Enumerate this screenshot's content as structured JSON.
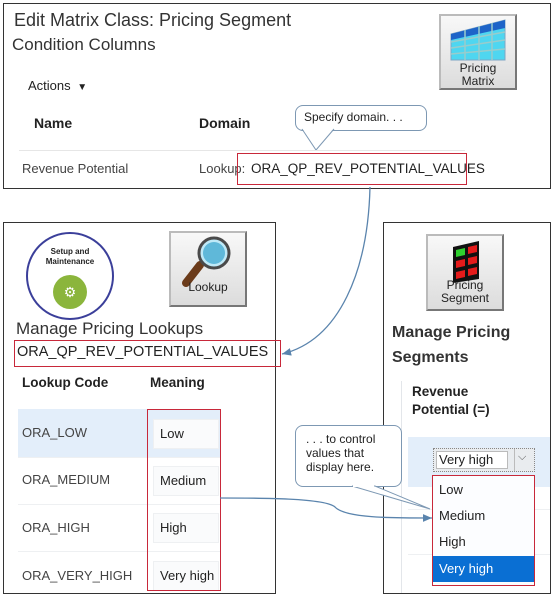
{
  "top_panel": {
    "title": "Edit Matrix Class: Pricing Segment",
    "subtitle": "Condition Columns",
    "actions_label": "Actions",
    "icon_tile": {
      "icon": "pricing-matrix-icon",
      "label_line1": "Pricing",
      "label_line2": "Matrix"
    },
    "table": {
      "headers": [
        "Name",
        "Domain"
      ],
      "rows": [
        {
          "name": "Revenue Potential",
          "domain_prefix": "Lookup:",
          "domain_value": "ORA_QP_REV_POTENTIAL_VALUES"
        }
      ]
    },
    "callout": "Specify domain. . ."
  },
  "left_panel": {
    "setup_badge": {
      "line1": "Setup and",
      "line2": "Maintenance",
      "icon": "gears-icon"
    },
    "lookup_tile": {
      "icon": "magnifier-icon",
      "label": "Lookup"
    },
    "title": "Manage Pricing Lookups",
    "lookup_type": "ORA_QP_REV_POTENTIAL_VALUES",
    "table": {
      "headers": [
        "Lookup Code",
        "Meaning"
      ],
      "rows": [
        {
          "code": "ORA_LOW",
          "meaning": "Low"
        },
        {
          "code": "ORA_MEDIUM",
          "meaning": "Medium"
        },
        {
          "code": "ORA_HIGH",
          "meaning": "High"
        },
        {
          "code": "ORA_VERY_HIGH",
          "meaning": "Very high"
        }
      ]
    }
  },
  "right_panel": {
    "segment_tile": {
      "icon": "pricing-segment-icon",
      "label_line1": "Pricing",
      "label_line2": "Segment"
    },
    "title_line1": "Manage Pricing",
    "title_line2": "Segments",
    "column_header_line1": "Revenue",
    "column_header_line2": "Potential (=)",
    "select": {
      "value": "Very high",
      "options": [
        "Low",
        "Medium",
        "High",
        "Very high"
      ],
      "highlighted": "Very high"
    }
  },
  "callout_bottom": {
    "line1": ". . . to control",
    "line2": "values  that",
    "line3": "display here."
  },
  "colors": {
    "highlight_red": "#c8283a",
    "selection_blue": "#0a6fd3",
    "row_highlight": "#e3eefa",
    "arrow": "#5a84ad"
  }
}
